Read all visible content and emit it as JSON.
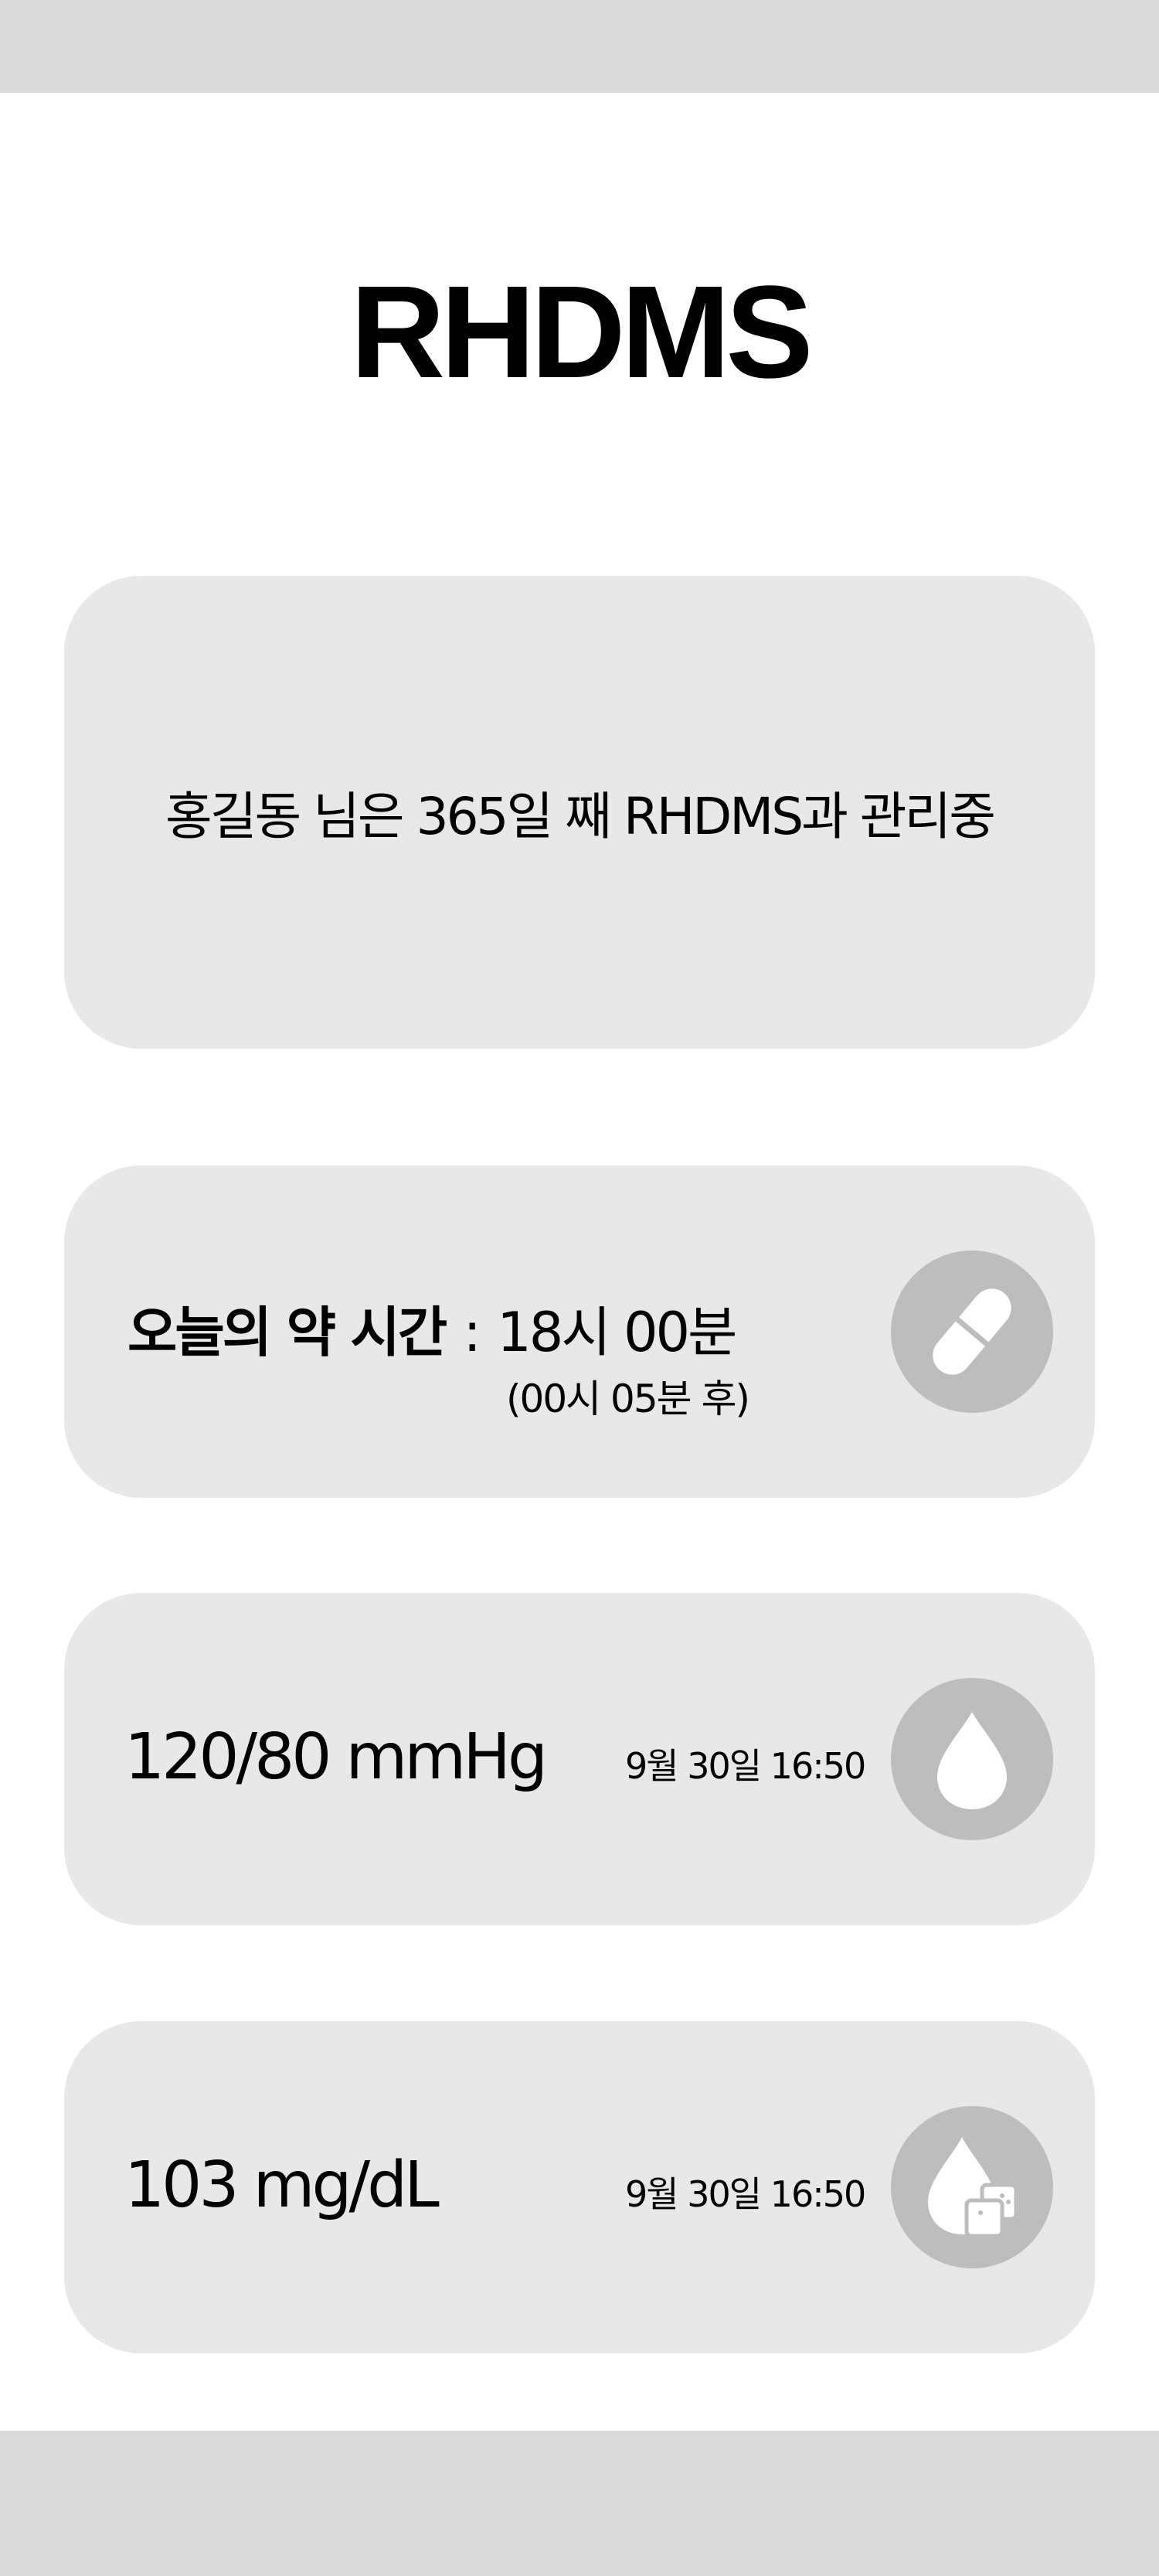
{
  "app": {
    "title": "RHDMS"
  },
  "status_card": {
    "text": "홍길동 님은 365일 째 RHDMS과 관리중"
  },
  "medication_card": {
    "label": "오늘의 약 시간",
    "separator": ":",
    "time": "18시 00분",
    "countdown": "(00시 05분 후)",
    "icon": "pill-icon"
  },
  "blood_pressure_card": {
    "value": "120/80 mmHg",
    "timestamp": "9월 30일 16:50",
    "icon": "blood-drop-icon"
  },
  "blood_glucose_card": {
    "value": "103 mg/dL",
    "timestamp": "9월 30일 16:50",
    "icon": "glucose-drop-icon"
  },
  "colors": {
    "bar": "#d9d9d9",
    "card": "#e8e8e8",
    "icon_circle": "#bdbdbd",
    "icon_fill": "#ffffff"
  }
}
